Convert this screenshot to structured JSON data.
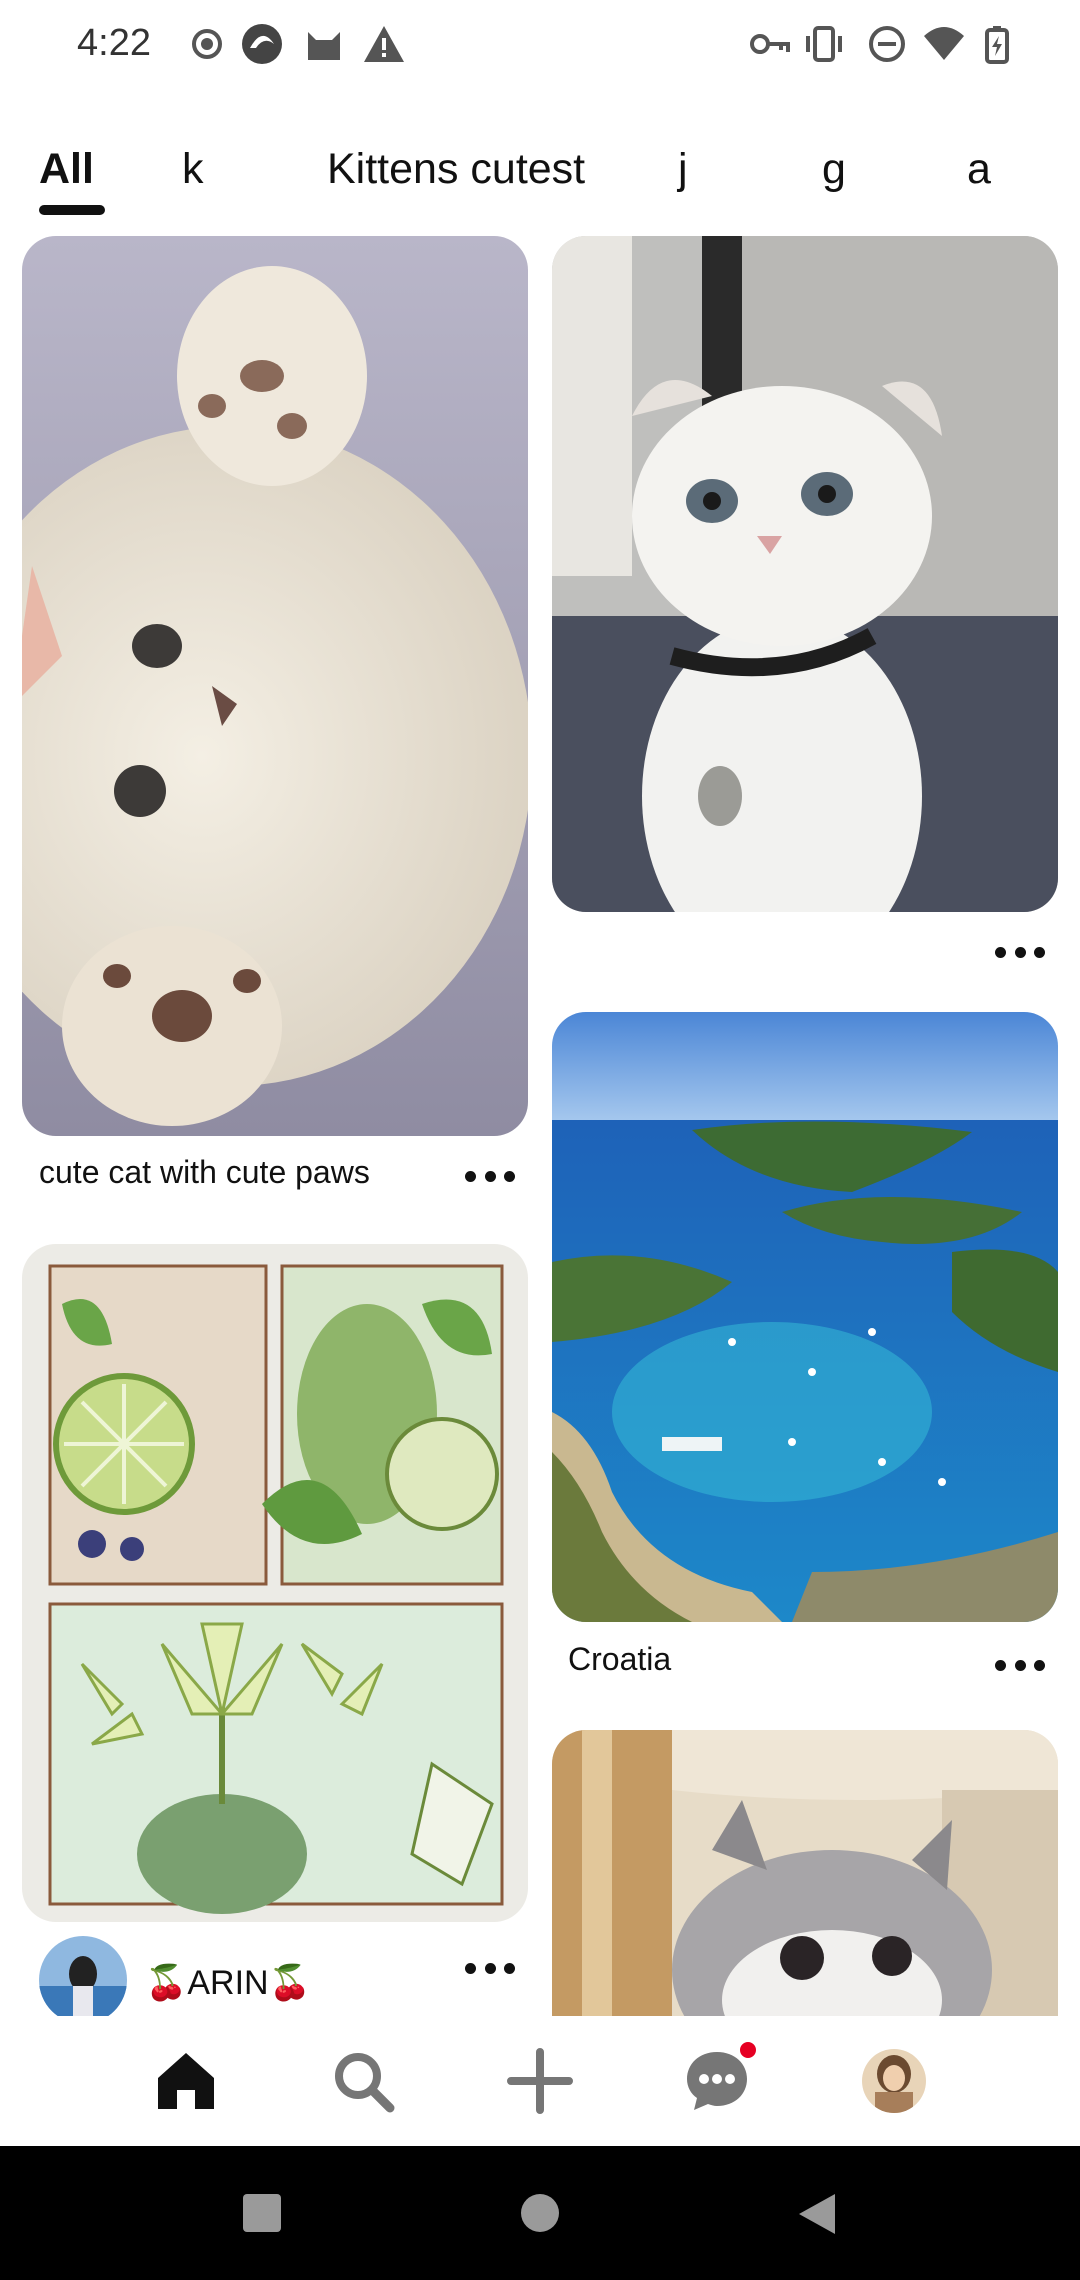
{
  "status_bar": {
    "time": "4:22",
    "left_icons": [
      "record-icon",
      "app-icon",
      "cat-icon",
      "warning-icon"
    ],
    "right_icons": [
      "vpn-key-icon",
      "vibrate-icon",
      "do-not-disturb-icon",
      "wifi-icon",
      "battery-icon"
    ]
  },
  "tabs": [
    {
      "label": "All",
      "active": true
    },
    {
      "label": "k"
    },
    {
      "label": "Kittens cutest"
    },
    {
      "label": "j"
    },
    {
      "label": "g"
    },
    {
      "label": "a"
    }
  ],
  "pins": {
    "left": [
      {
        "title": "cute cat with cute paws",
        "image": "white kitten showing paws"
      },
      {
        "creator": "🍒ARIN🍒",
        "image": "green lime and lily illustration"
      }
    ],
    "right": [
      {
        "title": "",
        "image": "white scottish fold cat"
      },
      {
        "title": "Croatia",
        "image": "aerial view of islands and bay"
      },
      {
        "title": "",
        "image": "grey kitten on shelf"
      }
    ]
  },
  "bottom_nav": {
    "items": [
      "home-icon",
      "search-icon",
      "create-icon",
      "messages-icon",
      "profile-avatar"
    ],
    "active": "home-icon",
    "messages_badge": true
  },
  "system_nav": [
    "recents-button",
    "home-button",
    "back-button"
  ],
  "colors": {
    "accent": "#e60023",
    "text": "#111111",
    "nav_bar": "#000000"
  }
}
